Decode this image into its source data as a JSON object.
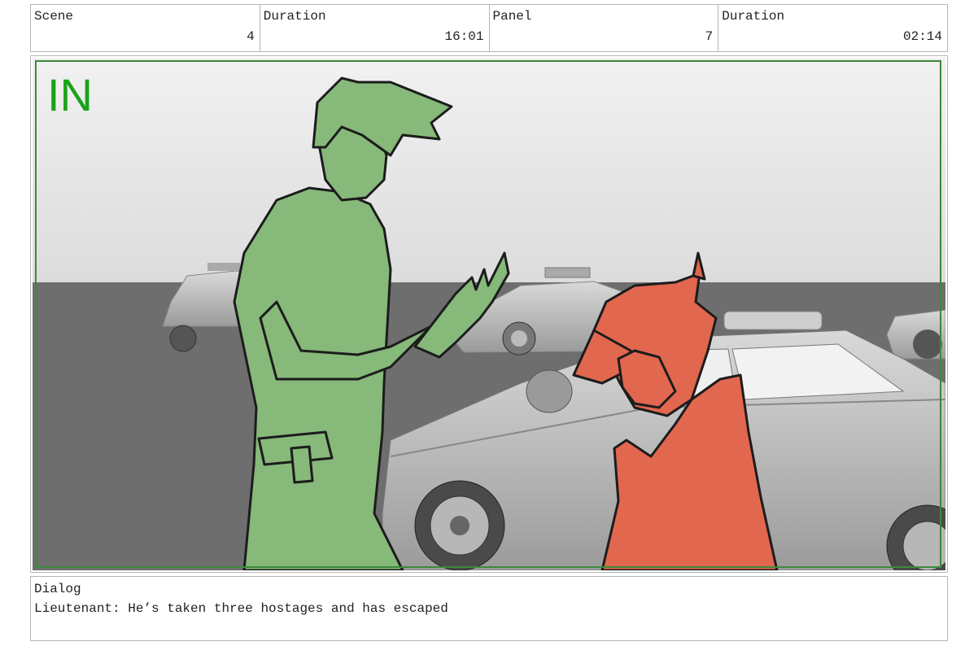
{
  "header": {
    "cells": [
      {
        "label": "Scene",
        "value": "4"
      },
      {
        "label": "Duration",
        "value": "16:01"
      },
      {
        "label": "Panel",
        "value": "7"
      },
      {
        "label": "Duration",
        "value": "02:14"
      }
    ]
  },
  "panel": {
    "tag": "IN",
    "colors": {
      "tag": "#1aa31a",
      "safe_frame": "#3c8a3c",
      "green_character": "#86b97a",
      "red_character": "#e2674f",
      "ground": "#6e6e6e",
      "sky": "#e8e8e8"
    }
  },
  "dialog": {
    "label": "Dialog",
    "text": "Lieutenant: He’s taken three hostages and has escaped"
  }
}
